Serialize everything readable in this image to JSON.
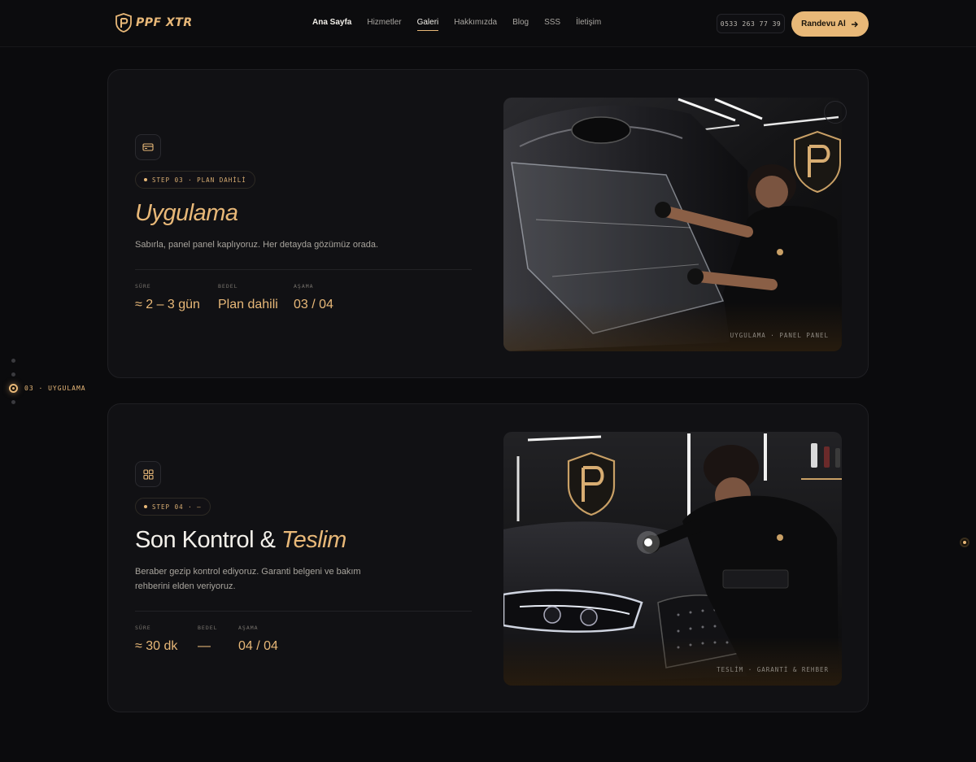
{
  "brand": {
    "logo_ppf": "PPF",
    "logo_xtr": "XTR",
    "accent": "#e8b878"
  },
  "nav": {
    "items": [
      {
        "label": "Ana Sayfa"
      },
      {
        "label": "Hizmetler"
      },
      {
        "label": "Galeri"
      },
      {
        "label": "Hakkımızda"
      },
      {
        "label": "Blog"
      },
      {
        "label": "SSS"
      },
      {
        "label": "İletişim"
      }
    ],
    "active": "Galeri",
    "phone": "0533 263 77 39",
    "cta": "Randevu Al",
    "cta_icon": "arrow-right-icon"
  },
  "page_progress": 0.74,
  "rail": {
    "active_label": "03 · UYGULAMA"
  },
  "steps": [
    {
      "icon": "card-icon",
      "pill": "STEP 03 · PLAN DAHİLİ",
      "title_gold": "Uygulama",
      "title_white": "",
      "desc": "Sabırla, panel panel kaplıyoruz. Her detayda gözümüz orada.",
      "stats": [
        {
          "label": "SÜRE",
          "value": "≈ 2 – 3 gün"
        },
        {
          "label": "BEDEL",
          "value": "Plan dahili"
        },
        {
          "label": "AŞAMA",
          "value": "03 / 04"
        }
      ],
      "caption": "UYGULAMA · PANEL PANEL"
    },
    {
      "icon": "grid-icon",
      "pill": "STEP 04 · —",
      "title_white": "Son Kontrol &",
      "title_gold": "Teslim",
      "desc_line1": "Beraber gezip kontrol ediyoruz. Garanti belgeni ve bakım",
      "desc_line2": "rehberini elden veriyoruz.",
      "stats": [
        {
          "label": "SÜRE",
          "value": "≈ 30 dk"
        },
        {
          "label": "BEDEL",
          "value": "—"
        },
        {
          "label": "AŞAMA",
          "value": "04 / 04"
        }
      ],
      "caption": "TESLİM · GARANTİ & REHBER"
    }
  ]
}
